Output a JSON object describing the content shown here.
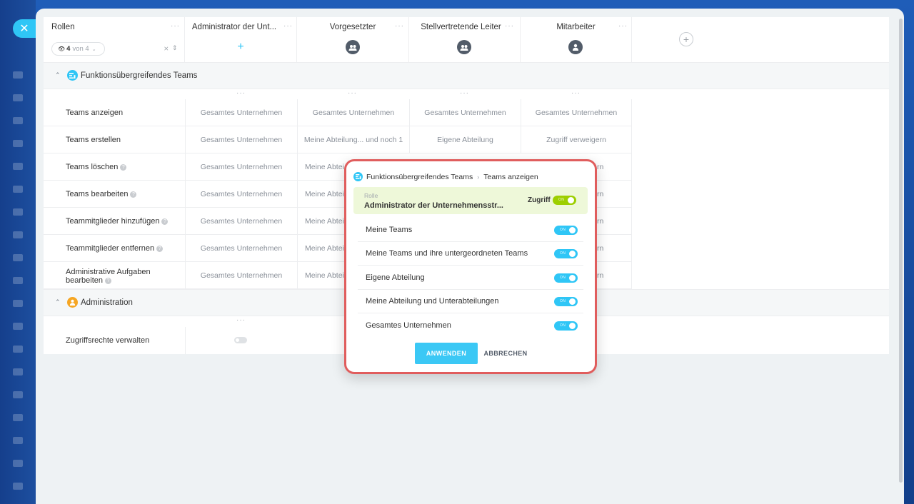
{
  "header": {
    "roles_title": "Rollen",
    "filter_count": "4",
    "filter_of": "von 4",
    "columns": [
      {
        "title": "Administrator der Unt...",
        "icon": "plus-icon"
      },
      {
        "title": "Vorgesetzter",
        "icon": "group-icon"
      },
      {
        "title": "Stellvertretende Leiter",
        "icon": "group-icon"
      },
      {
        "title": "Mitarbeiter",
        "icon": "user-icon"
      }
    ]
  },
  "sections": [
    {
      "title": "Funktionsübergreifendes Teams",
      "icon": "teams-icon",
      "rows": [
        {
          "label": "Teams anzeigen",
          "help": false,
          "values": [
            "Gesamtes Unternehmen",
            "Gesamtes Unternehmen",
            "Gesamtes Unternehmen",
            "Gesamtes Unternehmen"
          ]
        },
        {
          "label": "Teams erstellen",
          "help": false,
          "values": [
            "Gesamtes Unternehmen",
            "Meine Abteilung... und noch 1",
            "Eigene Abteilung",
            "Zugriff verweigern"
          ]
        },
        {
          "label": "Teams löschen",
          "help": true,
          "values": [
            "Gesamtes Unternehmen",
            "Meine Abtei",
            "",
            "rn"
          ]
        },
        {
          "label": "Teams bearbeiten",
          "help": true,
          "values": [
            "Gesamtes Unternehmen",
            "Meine Abtei",
            "",
            "rn"
          ]
        },
        {
          "label": "Teammitglieder hinzufügen",
          "help": true,
          "values": [
            "Gesamtes Unternehmen",
            "Meine Abtei",
            "",
            "rn"
          ]
        },
        {
          "label": "Teammitglieder entfernen",
          "help": true,
          "values": [
            "Gesamtes Unternehmen",
            "Meine Abtei",
            "",
            "rn"
          ]
        },
        {
          "label": "Administrative Aufgaben bearbeiten",
          "help": true,
          "values": [
            "Gesamtes Unternehmen",
            "Meine Abtei",
            "",
            "rn"
          ]
        }
      ]
    },
    {
      "title": "Administration",
      "icon": "admin-icon",
      "rows": [
        {
          "label": "Zugriffsrechte verwalten",
          "help": false,
          "toggle": "off"
        }
      ]
    }
  ],
  "popup": {
    "breadcrumb_section": "Funktionsübergreifendes Teams",
    "breadcrumb_page": "Teams anzeigen",
    "role_label": "Rolle",
    "role_name": "Administrator der Unternehmensstr...",
    "access_label": "Zugriff",
    "toggle_on_text": "ON",
    "options": [
      {
        "label": "Meine Teams",
        "state": "on"
      },
      {
        "label": "Meine Teams und ihre untergeordneten Teams",
        "state": "on"
      },
      {
        "label": "Eigene Abteilung",
        "state": "on"
      },
      {
        "label": "Meine Abteilung und Unterabteilungen",
        "state": "on"
      },
      {
        "label": "Gesamtes Unternehmen",
        "state": "on"
      }
    ],
    "apply_label": "ANWENDEN",
    "cancel_label": "ABBRECHEN"
  },
  "colors": {
    "accent": "#2fc6f6",
    "toggle_green": "#9dcf00",
    "popup_border": "#e05d5d",
    "admin_orange": "#f6a623"
  }
}
